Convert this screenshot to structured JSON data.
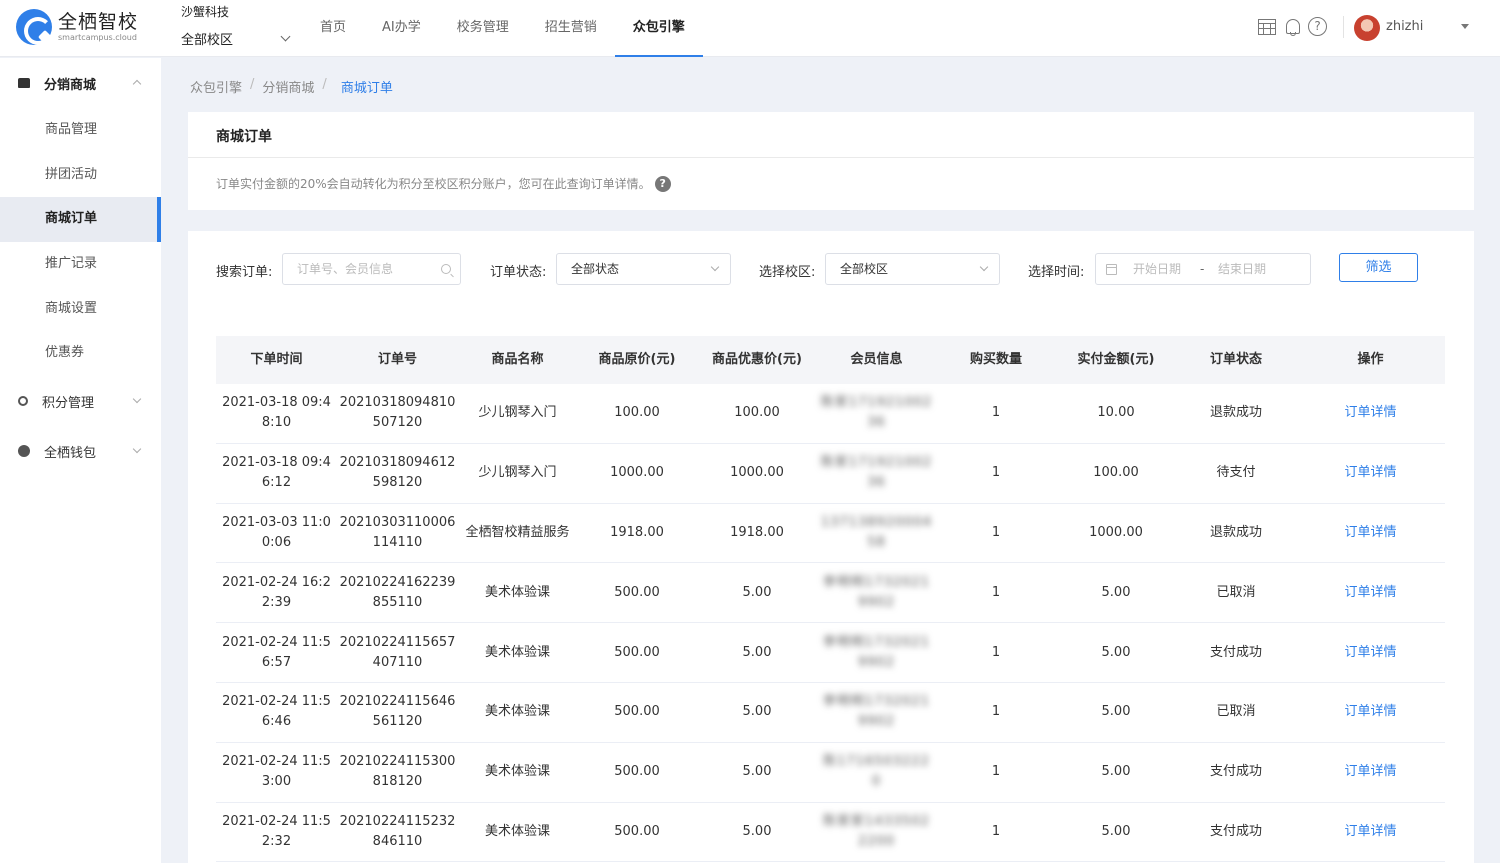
{
  "brand": {
    "name_cn": "全栖智校",
    "name_en": "smartcampus.cloud"
  },
  "org": {
    "name": "沙蟹科技",
    "campus": "全部校区"
  },
  "nav": [
    {
      "label": "首页"
    },
    {
      "label": "AI办学"
    },
    {
      "label": "校务管理"
    },
    {
      "label": "招生营销"
    },
    {
      "label": "众包引擎",
      "active": true
    }
  ],
  "user": {
    "name": "zhizhi"
  },
  "sidebar": {
    "groups": [
      {
        "label": "分销商城",
        "icon": "store-icon",
        "open": true,
        "items": [
          {
            "label": "商品管理"
          },
          {
            "label": "拼团活动"
          },
          {
            "label": "商城订单",
            "active": true
          },
          {
            "label": "推广记录"
          },
          {
            "label": "商城设置"
          },
          {
            "label": "优惠券"
          }
        ]
      },
      {
        "label": "积分管理",
        "icon": "medal-icon",
        "open": false
      },
      {
        "label": "全栖钱包",
        "icon": "wallet-icon",
        "open": false
      }
    ]
  },
  "breadcrumb": [
    "众包引擎",
    "分销商城",
    "商城订单"
  ],
  "page": {
    "title": "商城订单",
    "tip": "订单实付金额的20%会自动转化为积分至校区积分账户，您可在此查询订单详情。",
    "tip_icon": "?"
  },
  "filters": {
    "search_label": "搜索订单:",
    "search_placeholder": "订单号、会员信息",
    "status_label": "订单状态:",
    "status_value": "全部状态",
    "campus_label": "选择校区:",
    "campus_value": "全部校区",
    "time_label": "选择时间:",
    "date_start_placeholder": "开始日期",
    "date_sep": "-",
    "date_end_placeholder": "结束日期",
    "filter_button": "筛选"
  },
  "table": {
    "columns": [
      "下单时间",
      "订单号",
      "商品名称",
      "商品原价(元)",
      "商品优惠价(元)",
      "会员信息",
      "购买数量",
      "实付金额(元)",
      "订单状态",
      "操作"
    ],
    "rows": [
      {
        "time": "2021-03-18 09:48:10",
        "order_no": "20210318094810507120",
        "product": "少儿钢琴入门",
        "price": "100.00",
        "discount": "100.00",
        "member": "陈家17192100236",
        "qty": "1",
        "paid": "10.00",
        "status": "退款成功",
        "action": "订单详情"
      },
      {
        "time": "2021-03-18 09:46:12",
        "order_no": "20210318094612598120",
        "product": "少儿钢琴入门",
        "price": "1000.00",
        "discount": "1000.00",
        "member": "陈家17192100236",
        "qty": "1",
        "paid": "100.00",
        "status": "待支付",
        "action": "订单详情"
      },
      {
        "time": "2021-03-03 11:00:06",
        "order_no": "20210303110006114110",
        "product": "全栖智校精益服务",
        "price": "1918.00",
        "discount": "1918.00",
        "member": "13713892000458",
        "qty": "1",
        "paid": "1000.00",
        "status": "退款成功",
        "action": "订单详情"
      },
      {
        "time": "2021-02-24 16:22:39",
        "order_no": "20210224162239855110",
        "product": "美术体验课",
        "price": "500.00",
        "discount": "5.00",
        "member": "李明明17320219902",
        "qty": "1",
        "paid": "5.00",
        "status": "已取消",
        "action": "订单详情"
      },
      {
        "time": "2021-02-24 11:56:57",
        "order_no": "20210224115657407110",
        "product": "美术体验课",
        "price": "500.00",
        "discount": "5.00",
        "member": "李明明17320219902",
        "qty": "1",
        "paid": "5.00",
        "status": "支付成功",
        "action": "订单详情"
      },
      {
        "time": "2021-02-24 11:56:46",
        "order_no": "20210224115646561120",
        "product": "美术体验课",
        "price": "500.00",
        "discount": "5.00",
        "member": "李明明17320219902",
        "qty": "1",
        "paid": "5.00",
        "status": "已取消",
        "action": "订单详情"
      },
      {
        "time": "2021-02-24 11:53:00",
        "order_no": "20210224115300818120",
        "product": "美术体验课",
        "price": "500.00",
        "discount": "5.00",
        "member": "陈17165032220",
        "qty": "1",
        "paid": "5.00",
        "status": "支付成功",
        "action": "订单详情"
      },
      {
        "time": "2021-02-24 11:52:32",
        "order_no": "20210224115232846110",
        "product": "美术体验课",
        "price": "500.00",
        "discount": "5.00",
        "member": "陈家家14335022200",
        "qty": "1",
        "paid": "5.00",
        "status": "支付成功",
        "action": "订单详情"
      }
    ]
  },
  "colors": {
    "accent": "#2f7fe8",
    "background": "#eef1f7",
    "header_row": "#f4f5f8"
  }
}
